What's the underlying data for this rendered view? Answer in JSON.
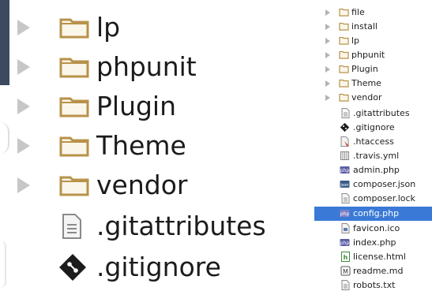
{
  "zoom": {
    "items": [
      {
        "label": "lp",
        "icon": "folder-icon",
        "expandable": true
      },
      {
        "label": "phpunit",
        "icon": "folder-icon",
        "expandable": true
      },
      {
        "label": "Plugin",
        "icon": "folder-icon",
        "expandable": true
      },
      {
        "label": "Theme",
        "icon": "folder-icon",
        "expandable": true
      },
      {
        "label": "vendor",
        "icon": "folder-icon",
        "expandable": true
      },
      {
        "label": ".gitattributes",
        "icon": "text-file-icon",
        "expandable": false
      },
      {
        "label": ".gitignore",
        "icon": "git-icon",
        "expandable": false
      }
    ]
  },
  "tree": {
    "items": [
      {
        "label": "file",
        "icon": "folder-icon",
        "expandable": true
      },
      {
        "label": "install",
        "icon": "folder-icon",
        "expandable": true
      },
      {
        "label": "lp",
        "icon": "folder-icon",
        "expandable": true
      },
      {
        "label": "phpunit",
        "icon": "folder-icon",
        "expandable": true
      },
      {
        "label": "Plugin",
        "icon": "folder-icon",
        "expandable": true
      },
      {
        "label": "Theme",
        "icon": "folder-icon",
        "expandable": true
      },
      {
        "label": "vendor",
        "icon": "folder-icon",
        "expandable": true
      },
      {
        "label": ".gitattributes",
        "icon": "text-file-icon",
        "expandable": false
      },
      {
        "label": ".gitignore",
        "icon": "git-icon",
        "expandable": false
      },
      {
        "label": ".htaccess",
        "icon": "htaccess-icon",
        "expandable": false
      },
      {
        "label": ".travis.yml",
        "icon": "yml-file-icon",
        "expandable": false
      },
      {
        "label": "admin.php",
        "icon": "php-file-icon",
        "expandable": false
      },
      {
        "label": "composer.json",
        "icon": "json-file-icon",
        "expandable": false
      },
      {
        "label": "composer.lock",
        "icon": "text-file-icon",
        "expandable": false
      },
      {
        "label": "config.php",
        "icon": "php-file-icon",
        "expandable": false,
        "selected": true
      },
      {
        "label": "favicon.ico",
        "icon": "image-file-icon",
        "expandable": false
      },
      {
        "label": "index.php",
        "icon": "php-file-icon",
        "expandable": false
      },
      {
        "label": "license.html",
        "icon": "html-file-icon",
        "expandable": false
      },
      {
        "label": "readme.md",
        "icon": "markdown-file-icon",
        "expandable": false
      },
      {
        "label": "robots.txt",
        "icon": "text-file-icon",
        "expandable": false
      }
    ]
  },
  "colors": {
    "selection": "#3a7ad6",
    "folder": "#c9a25a",
    "arrow": "#b3b3b3"
  }
}
